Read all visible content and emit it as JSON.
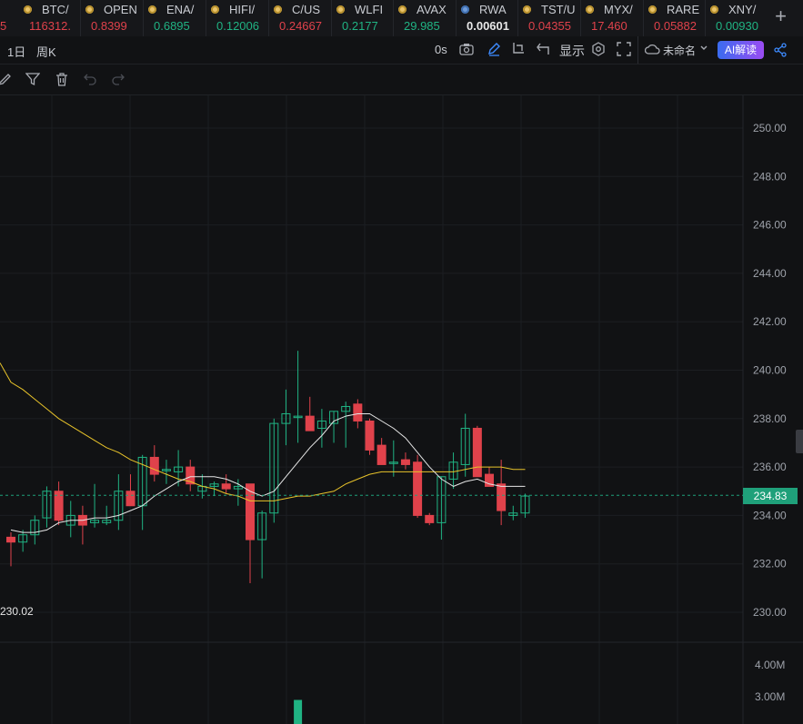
{
  "tickers": [
    {
      "symbol": "BTC/",
      "price": "116312.",
      "price_color": "red",
      "icon": "coin-icon"
    },
    {
      "symbol": "OPEN",
      "price": "0.8399",
      "price_color": "red",
      "icon": "coin-icon"
    },
    {
      "symbol": "ENA/",
      "price": "0.6895",
      "price_color": "green",
      "icon": "coin-icon"
    },
    {
      "symbol": "HIFI/",
      "price": "0.12006",
      "price_color": "green",
      "icon": "coin-icon"
    },
    {
      "symbol": "C/US",
      "price": "0.24667",
      "price_color": "red",
      "icon": "coin-icon"
    },
    {
      "symbol": "WLFI",
      "price": "0.2177",
      "price_color": "green",
      "icon": "coin-icon"
    },
    {
      "symbol": "AVAX",
      "price": "29.985",
      "price_color": "green",
      "icon": "coin-icon"
    },
    {
      "symbol": "RWA",
      "price": "0.00601",
      "price_color": "white",
      "icon": "coin-icon"
    },
    {
      "symbol": "TST/U",
      "price": "0.04355",
      "price_color": "red",
      "icon": "coin-icon"
    },
    {
      "symbol": "MYX/",
      "price": "17.460",
      "price_color": "red",
      "icon": "coin-icon"
    },
    {
      "symbol": "RARE",
      "price": "0.05882",
      "price_color": "red",
      "icon": "coin-icon"
    },
    {
      "symbol": "XNY/",
      "price": "0.00930",
      "price_color": "green",
      "icon": "coin-icon"
    }
  ],
  "ticker_partial_price": "5",
  "toolbar": {
    "interval_day": "1日",
    "interval_week": "周K",
    "countdown": "0s",
    "display_label": "显示",
    "layout_name": "未命名",
    "ai_button": "AI解读"
  },
  "chart_data": {
    "type": "candlestick",
    "y_ticks": [
      "250.00",
      "248.00",
      "246.00",
      "244.00",
      "242.00",
      "240.00",
      "238.00",
      "236.00",
      "234.00",
      "232.00",
      "230.00"
    ],
    "volume_ticks": [
      "4.00M",
      "3.00M"
    ],
    "ylim": [
      229.5,
      250.5
    ],
    "current_price": "234.83",
    "low_marker": "230.02",
    "colors": {
      "up": "#20b383",
      "down": "#e0424b",
      "ma_fast": "#e6e6e6",
      "ma_slow": "#e8c32a",
      "grid": "#1c1e22",
      "current_line": "#1fa07a"
    },
    "candles": [
      [
        233.1,
        233.3,
        231.9,
        232.9
      ],
      [
        232.9,
        233.4,
        232.5,
        233.2
      ],
      [
        233.2,
        234.0,
        232.8,
        233.8
      ],
      [
        233.9,
        235.2,
        233.5,
        235.0
      ],
      [
        235.0,
        235.4,
        233.6,
        233.8
      ],
      [
        233.6,
        234.6,
        233.1,
        234.0
      ],
      [
        234.0,
        234.4,
        232.8,
        233.6
      ],
      [
        233.7,
        235.3,
        233.5,
        233.8
      ],
      [
        233.7,
        234.4,
        233.6,
        233.8
      ],
      [
        233.8,
        235.7,
        233.4,
        235.0
      ],
      [
        235.0,
        235.7,
        234.6,
        234.4
      ],
      [
        234.4,
        236.5,
        233.4,
        236.4
      ],
      [
        236.4,
        236.9,
        235.4,
        235.7
      ],
      [
        235.9,
        236.3,
        235.3,
        235.9
      ],
      [
        235.8,
        236.7,
        235.2,
        236.0
      ],
      [
        236.0,
        236.3,
        235.0,
        235.3
      ],
      [
        235.0,
        235.7,
        234.7,
        235.2
      ],
      [
        235.2,
        235.4,
        234.8,
        235.3
      ],
      [
        235.3,
        235.7,
        234.9,
        235.1
      ],
      [
        235.1,
        235.5,
        234.4,
        235.2
      ],
      [
        235.3,
        235.3,
        231.2,
        233.0
      ],
      [
        233.0,
        234.2,
        231.4,
        234.1
      ],
      [
        234.1,
        238.0,
        233.7,
        237.8
      ],
      [
        237.8,
        239.2,
        236.9,
        238.2
      ],
      [
        238.1,
        240.8,
        237.0,
        238.1
      ],
      [
        238.1,
        238.9,
        237.5,
        237.5
      ],
      [
        237.6,
        238.4,
        236.8,
        237.9
      ],
      [
        237.8,
        238.3,
        237.0,
        238.3
      ],
      [
        238.3,
        238.7,
        236.8,
        238.5
      ],
      [
        238.6,
        238.8,
        237.6,
        237.9
      ],
      [
        237.9,
        238.0,
        236.5,
        236.7
      ],
      [
        236.9,
        237.2,
        236.1,
        236.1
      ],
      [
        236.2,
        237.1,
        235.6,
        236.2
      ],
      [
        236.3,
        236.6,
        235.9,
        236.1
      ],
      [
        236.2,
        236.5,
        233.9,
        234.0
      ],
      [
        234.0,
        234.1,
        233.6,
        233.7
      ],
      [
        233.7,
        235.6,
        233.0,
        235.6
      ],
      [
        235.5,
        236.6,
        235.1,
        236.2
      ],
      [
        236.1,
        238.2,
        235.6,
        237.6
      ],
      [
        237.6,
        237.7,
        235.6,
        235.6
      ],
      [
        235.7,
        236.0,
        235.2,
        235.2
      ],
      [
        235.3,
        236.3,
        233.6,
        234.2
      ],
      [
        234.0,
        234.4,
        233.8,
        234.1
      ],
      [
        234.1,
        234.9,
        233.9,
        234.8
      ]
    ],
    "ma_fast": [
      233.4,
      233.3,
      233.3,
      233.4,
      233.7,
      233.8,
      233.8,
      233.9,
      233.9,
      234.0,
      234.2,
      234.4,
      234.8,
      235.1,
      235.4,
      235.6,
      235.6,
      235.6,
      235.5,
      235.3,
      235.0,
      234.8,
      235.0,
      235.6,
      236.2,
      236.8,
      237.3,
      237.9,
      238.1,
      238.2,
      238.2,
      237.9,
      237.6,
      237.2,
      236.6,
      236.0,
      235.5,
      235.2,
      235.4,
      235.5,
      235.3,
      235.2,
      235.2,
      235.2
    ],
    "ma_slow": [
      239.5,
      239.2,
      238.8,
      238.4,
      238.0,
      237.7,
      237.4,
      237.1,
      236.8,
      236.6,
      236.3,
      236.1,
      235.9,
      235.7,
      235.5,
      235.4,
      235.2,
      235.1,
      234.9,
      234.8,
      234.6,
      234.6,
      234.6,
      234.7,
      234.8,
      234.8,
      234.9,
      235.0,
      235.3,
      235.5,
      235.7,
      235.8,
      235.8,
      235.8,
      235.8,
      235.8,
      235.8,
      235.8,
      235.9,
      236.0,
      236.0,
      236.0,
      235.9,
      235.9
    ],
    "volume_visible": [
      null,
      null,
      null,
      null,
      null,
      null,
      null,
      null,
      null,
      null,
      null,
      null,
      null,
      null,
      null,
      null,
      null,
      null,
      null,
      null,
      null,
      null,
      null,
      null,
      2.9,
      null,
      null,
      null,
      null,
      null,
      null,
      null,
      null,
      null,
      null,
      null,
      null,
      null,
      null,
      null,
      null,
      null,
      null,
      null
    ]
  }
}
